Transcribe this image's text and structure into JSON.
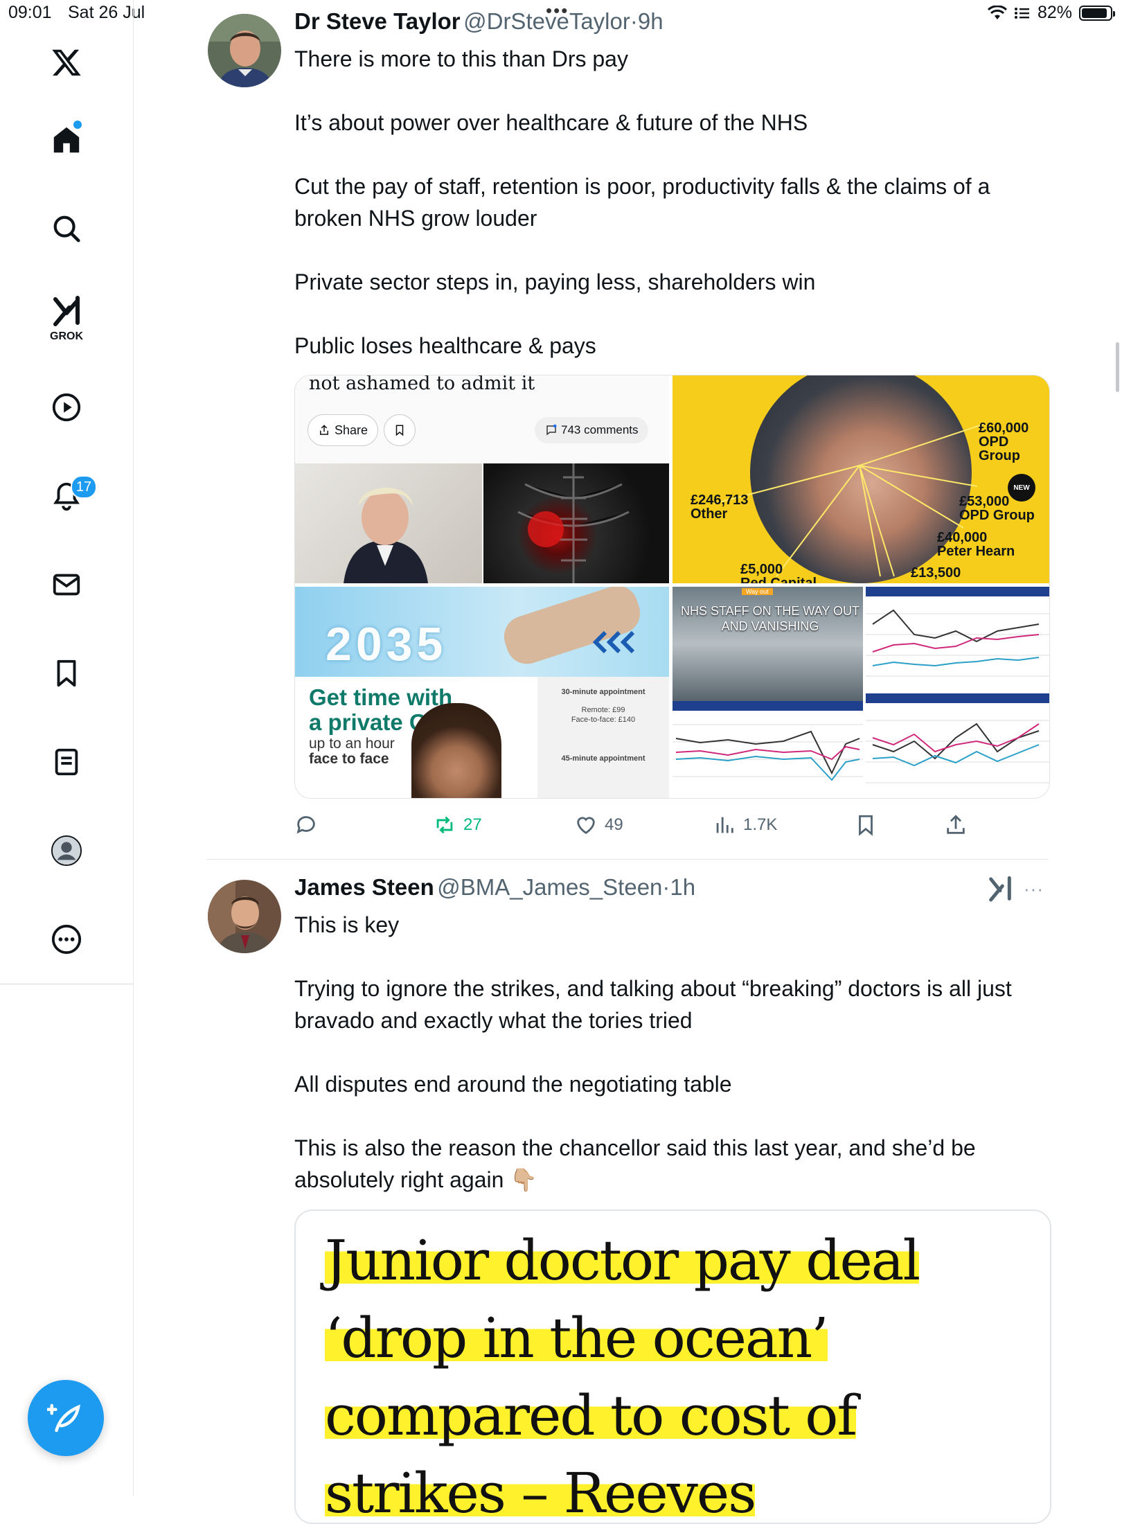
{
  "status_bar": {
    "time": "09:01",
    "date": "Sat 26 Jul",
    "battery": "82%",
    "battery_level": 0.82
  },
  "sidebar": {
    "items": [
      {
        "icon": "x-logo-icon"
      },
      {
        "icon": "home-icon"
      },
      {
        "icon": "search-icon"
      },
      {
        "icon": "grok-icon",
        "label": "GROK"
      },
      {
        "icon": "video-icon"
      },
      {
        "icon": "notifications-icon",
        "badge": "17"
      },
      {
        "icon": "messages-icon"
      },
      {
        "icon": "bookmarks-icon"
      },
      {
        "icon": "lists-icon"
      },
      {
        "icon": "profile-icon"
      },
      {
        "icon": "more-icon"
      }
    ],
    "accent": "#1d9bf0"
  },
  "tweet1": {
    "name": "Dr Steve Taylor",
    "handle": "@DrSteveTaylor",
    "sep": "·",
    "time": "9h",
    "lines": [
      "There is more to this than Drs pay",
      "",
      "It’s about power over healthcare & future of the NHS",
      "",
      "Cut the pay of staff, retention is poor, productivity falls & the claims of a broken NHS grow louder",
      "",
      "Private sector steps in, paying less, shareholders win",
      "",
      "Public loses healthcare & pays"
    ],
    "media": {
      "img1": {
        "caption": "not ashamed to admit it",
        "share": "Share",
        "comments": "743 comments"
      },
      "img2": {
        "labels": [
          "£60,000",
          "OPD",
          "Group",
          "NEW",
          "£53,000",
          "OPD Group",
          "£246,713",
          "Other",
          "£40,000",
          "Peter Hearn",
          "£5,000",
          "Red Capital",
          "£13,500"
        ]
      },
      "img3": {
        "year": "2035",
        "headline1": "Get time with",
        "headline2": "a private GP",
        "sub1": "up to an hour",
        "sub2": "face to face",
        "appt30": "30-minute appointment",
        "remote": "Remote: £99",
        "face": "Face-to-face: £140",
        "appt45": "45-minute appointment"
      },
      "img4": {
        "title1": "NHS STAFF ON THE WAY OUT",
        "title2": "AND VANISHING",
        "tag": "Way out"
      }
    },
    "actions": {
      "replies": "",
      "reposts": "27",
      "likes": "49",
      "views": "1.7K"
    }
  },
  "tweet2": {
    "name": "James Steen",
    "handle": "@BMA_James_Steen",
    "sep": "·",
    "time": "1h",
    "more": "···",
    "lines": [
      "This is key",
      "",
      "Trying to ignore the strikes, and talking about “breaking” doctors is all just bravado and exactly what the tories tried",
      "",
      "All disputes end around the negotiating table",
      "",
      "This is also the reason the chancellor said this last year, and she’d be absolutely right again 👇🏼"
    ],
    "card": {
      "line1": "Junior doctor pay deal",
      "line2": "‘drop in the ocean’",
      "line3": "compared to cost of",
      "line4": "strikes – Reeves"
    }
  }
}
